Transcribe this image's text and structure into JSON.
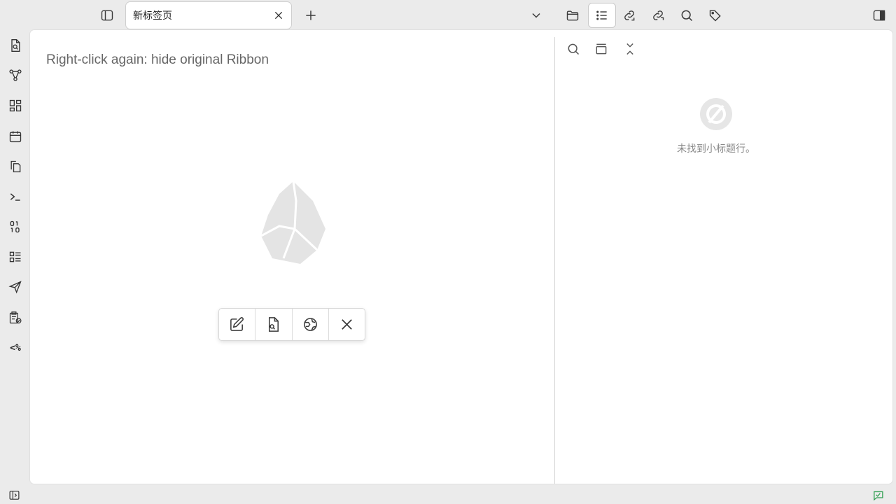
{
  "titlebar": {
    "tab_title": "新标签页",
    "icons": [
      "sidebar-toggle-icon",
      "close-icon",
      "plus-icon",
      "chevron-down-icon",
      "folder-icon",
      "list-icon",
      "backlink-icon",
      "outgoing-link-icon",
      "search-icon",
      "tag-icon",
      "right-sidebar-toggle-icon"
    ]
  },
  "ribbon": {
    "icons": [
      "file-search-icon",
      "graph-icon",
      "layout-icon",
      "calendar-icon",
      "copy-icon",
      "terminal-icon",
      "binary-icon",
      "checklist-icon",
      "send-icon",
      "clipboard-check-icon"
    ],
    "templater_text": "<%"
  },
  "editor": {
    "hint": "Right-click again: hide original Ribbon",
    "toolbar_icons": [
      "edit-icon",
      "file-search-icon",
      "globe-icon",
      "close-icon"
    ]
  },
  "side_panel": {
    "icons": [
      "search-icon",
      "collapse-panel-icon",
      "collapse-all-icon"
    ],
    "empty_text": "未找到小标题行。"
  },
  "statusbar": {
    "icons": [
      "sidebar-expand-icon",
      "sync-check-icon"
    ],
    "accent": "#2e9e4f"
  },
  "colors": {
    "background": "#ebebeb",
    "surface": "#ffffff",
    "muted_text": "#888888"
  }
}
